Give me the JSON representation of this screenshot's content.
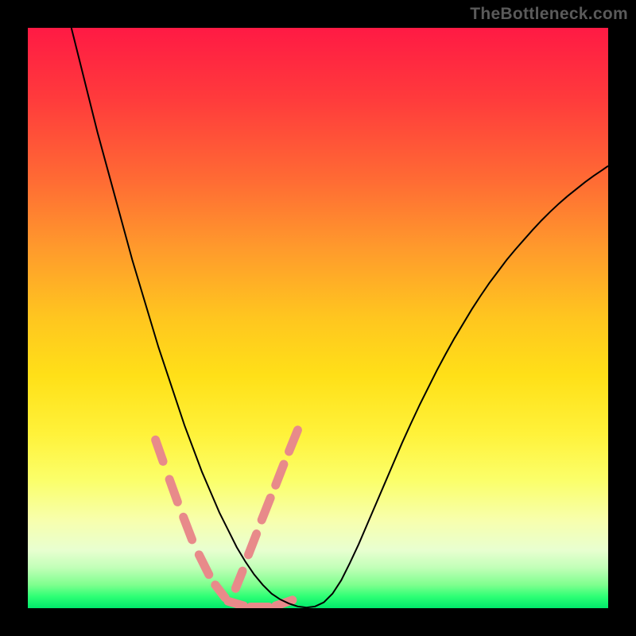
{
  "watermark": "TheBottleneck.com",
  "chart_data": {
    "type": "line",
    "title": "",
    "xlabel": "",
    "ylabel": "",
    "xlim": [
      0,
      1
    ],
    "ylim": [
      0,
      1
    ],
    "background_gradient_stops": [
      {
        "pos": 0.0,
        "color": "#ff1a44"
      },
      {
        "pos": 0.12,
        "color": "#ff3a3c"
      },
      {
        "pos": 0.26,
        "color": "#ff6a34"
      },
      {
        "pos": 0.38,
        "color": "#ff9a2c"
      },
      {
        "pos": 0.5,
        "color": "#ffc61f"
      },
      {
        "pos": 0.6,
        "color": "#ffe018"
      },
      {
        "pos": 0.7,
        "color": "#fff23a"
      },
      {
        "pos": 0.78,
        "color": "#fbff6a"
      },
      {
        "pos": 0.85,
        "color": "#f7ffae"
      },
      {
        "pos": 0.9,
        "color": "#e8ffd0"
      },
      {
        "pos": 0.93,
        "color": "#c2ffb8"
      },
      {
        "pos": 0.96,
        "color": "#7eff8e"
      },
      {
        "pos": 0.98,
        "color": "#2dff75"
      },
      {
        "pos": 1.0,
        "color": "#00e86a"
      }
    ],
    "series": [
      {
        "name": "bottleneck-curve",
        "color": "#000000",
        "stroke_width": 2,
        "x": [
          0.075,
          0.09,
          0.105,
          0.12,
          0.135,
          0.15,
          0.165,
          0.18,
          0.195,
          0.21,
          0.225,
          0.24,
          0.255,
          0.27,
          0.285,
          0.3,
          0.315,
          0.33,
          0.345,
          0.36,
          0.375,
          0.39,
          0.405,
          0.42,
          0.435,
          0.45,
          0.465,
          0.48,
          0.495,
          0.51,
          0.525,
          0.54,
          0.555,
          0.57,
          0.585,
          0.6,
          0.615,
          0.63,
          0.645,
          0.66,
          0.675,
          0.69,
          0.705,
          0.72,
          0.735,
          0.75,
          0.765,
          0.78,
          0.795,
          0.81,
          0.825,
          0.84,
          0.855,
          0.87,
          0.885,
          0.9,
          0.915,
          0.93,
          0.945,
          0.96,
          0.975,
          0.99,
          1.0
        ],
        "y": [
          1.0,
          0.94,
          0.88,
          0.82,
          0.765,
          0.71,
          0.655,
          0.6,
          0.55,
          0.5,
          0.45,
          0.405,
          0.36,
          0.315,
          0.275,
          0.235,
          0.2,
          0.165,
          0.135,
          0.105,
          0.08,
          0.058,
          0.04,
          0.025,
          0.015,
          0.008,
          0.003,
          0.001,
          0.003,
          0.01,
          0.025,
          0.048,
          0.078,
          0.11,
          0.145,
          0.18,
          0.215,
          0.25,
          0.285,
          0.318,
          0.35,
          0.38,
          0.41,
          0.438,
          0.465,
          0.49,
          0.515,
          0.538,
          0.56,
          0.58,
          0.6,
          0.618,
          0.635,
          0.652,
          0.668,
          0.683,
          0.697,
          0.71,
          0.722,
          0.734,
          0.745,
          0.755,
          0.762
        ]
      }
    ],
    "dash_markers": [
      {
        "name": "left-branch-dashes",
        "color": "#e88a8a",
        "stroke_width": 11,
        "segments": [
          {
            "x1": 0.22,
            "y1": 0.29,
            "x2": 0.233,
            "y2": 0.253
          },
          {
            "x1": 0.244,
            "y1": 0.222,
            "x2": 0.258,
            "y2": 0.183
          },
          {
            "x1": 0.268,
            "y1": 0.157,
            "x2": 0.283,
            "y2": 0.118
          },
          {
            "x1": 0.295,
            "y1": 0.092,
            "x2": 0.312,
            "y2": 0.058
          },
          {
            "x1": 0.323,
            "y1": 0.04,
            "x2": 0.34,
            "y2": 0.018
          }
        ]
      },
      {
        "name": "minimum-dashes",
        "color": "#e88a8a",
        "stroke_width": 11,
        "segments": [
          {
            "x1": 0.345,
            "y1": 0.012,
            "x2": 0.372,
            "y2": 0.004
          },
          {
            "x1": 0.384,
            "y1": 0.002,
            "x2": 0.415,
            "y2": 0.002
          },
          {
            "x1": 0.427,
            "y1": 0.004,
            "x2": 0.456,
            "y2": 0.014
          }
        ]
      },
      {
        "name": "right-branch-dashes",
        "color": "#e88a8a",
        "stroke_width": 11,
        "segments": [
          {
            "x1": 0.358,
            "y1": 0.034,
            "x2": 0.37,
            "y2": 0.064
          },
          {
            "x1": 0.38,
            "y1": 0.092,
            "x2": 0.394,
            "y2": 0.128
          },
          {
            "x1": 0.403,
            "y1": 0.152,
            "x2": 0.418,
            "y2": 0.19
          },
          {
            "x1": 0.427,
            "y1": 0.212,
            "x2": 0.441,
            "y2": 0.248
          },
          {
            "x1": 0.45,
            "y1": 0.27,
            "x2": 0.465,
            "y2": 0.307
          }
        ]
      }
    ]
  }
}
